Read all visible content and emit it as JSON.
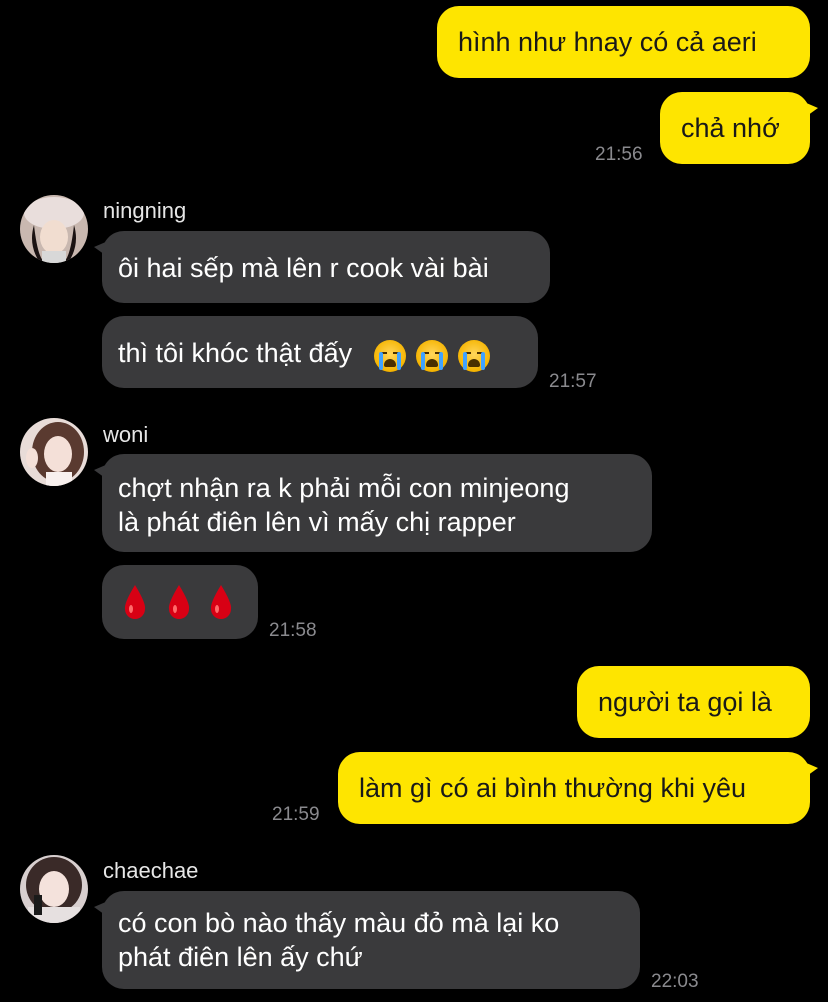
{
  "messages": {
    "m1": "hình như hnay có cả aeri",
    "m2": "chả nhớ",
    "m2_time": "21:56",
    "ningning_name": "ningning",
    "m3": "ôi hai sếp mà lên r cook vài bài",
    "m4": "thì tôi khóc thật đấy",
    "m4_emoji": "loudly-crying-face x3",
    "m4_time": "21:57",
    "woni_name": "woni",
    "m5_line1": "chợt nhận ra k phải mỗi con minjeong",
    "m5_line2": "là phát điên lên vì mấy chị rapper",
    "m6_emoji": "drop-of-blood x3",
    "m6_time": "21:58",
    "m7": "người ta gọi là",
    "m8": "làm gì có ai bình thường khi yêu",
    "m8_time": "21:59",
    "chaechae_name": "chaechae",
    "m9_line1": "có con bò nào thấy màu đỏ mà lại ko",
    "m9_line2": "phát điên lên ấy chứ",
    "m9_time": "22:03"
  },
  "colors": {
    "outgoing_bubble": "#fee500",
    "incoming_bubble": "#3a3a3c",
    "background": "#000000",
    "timestamp": "#8a8a8e"
  }
}
